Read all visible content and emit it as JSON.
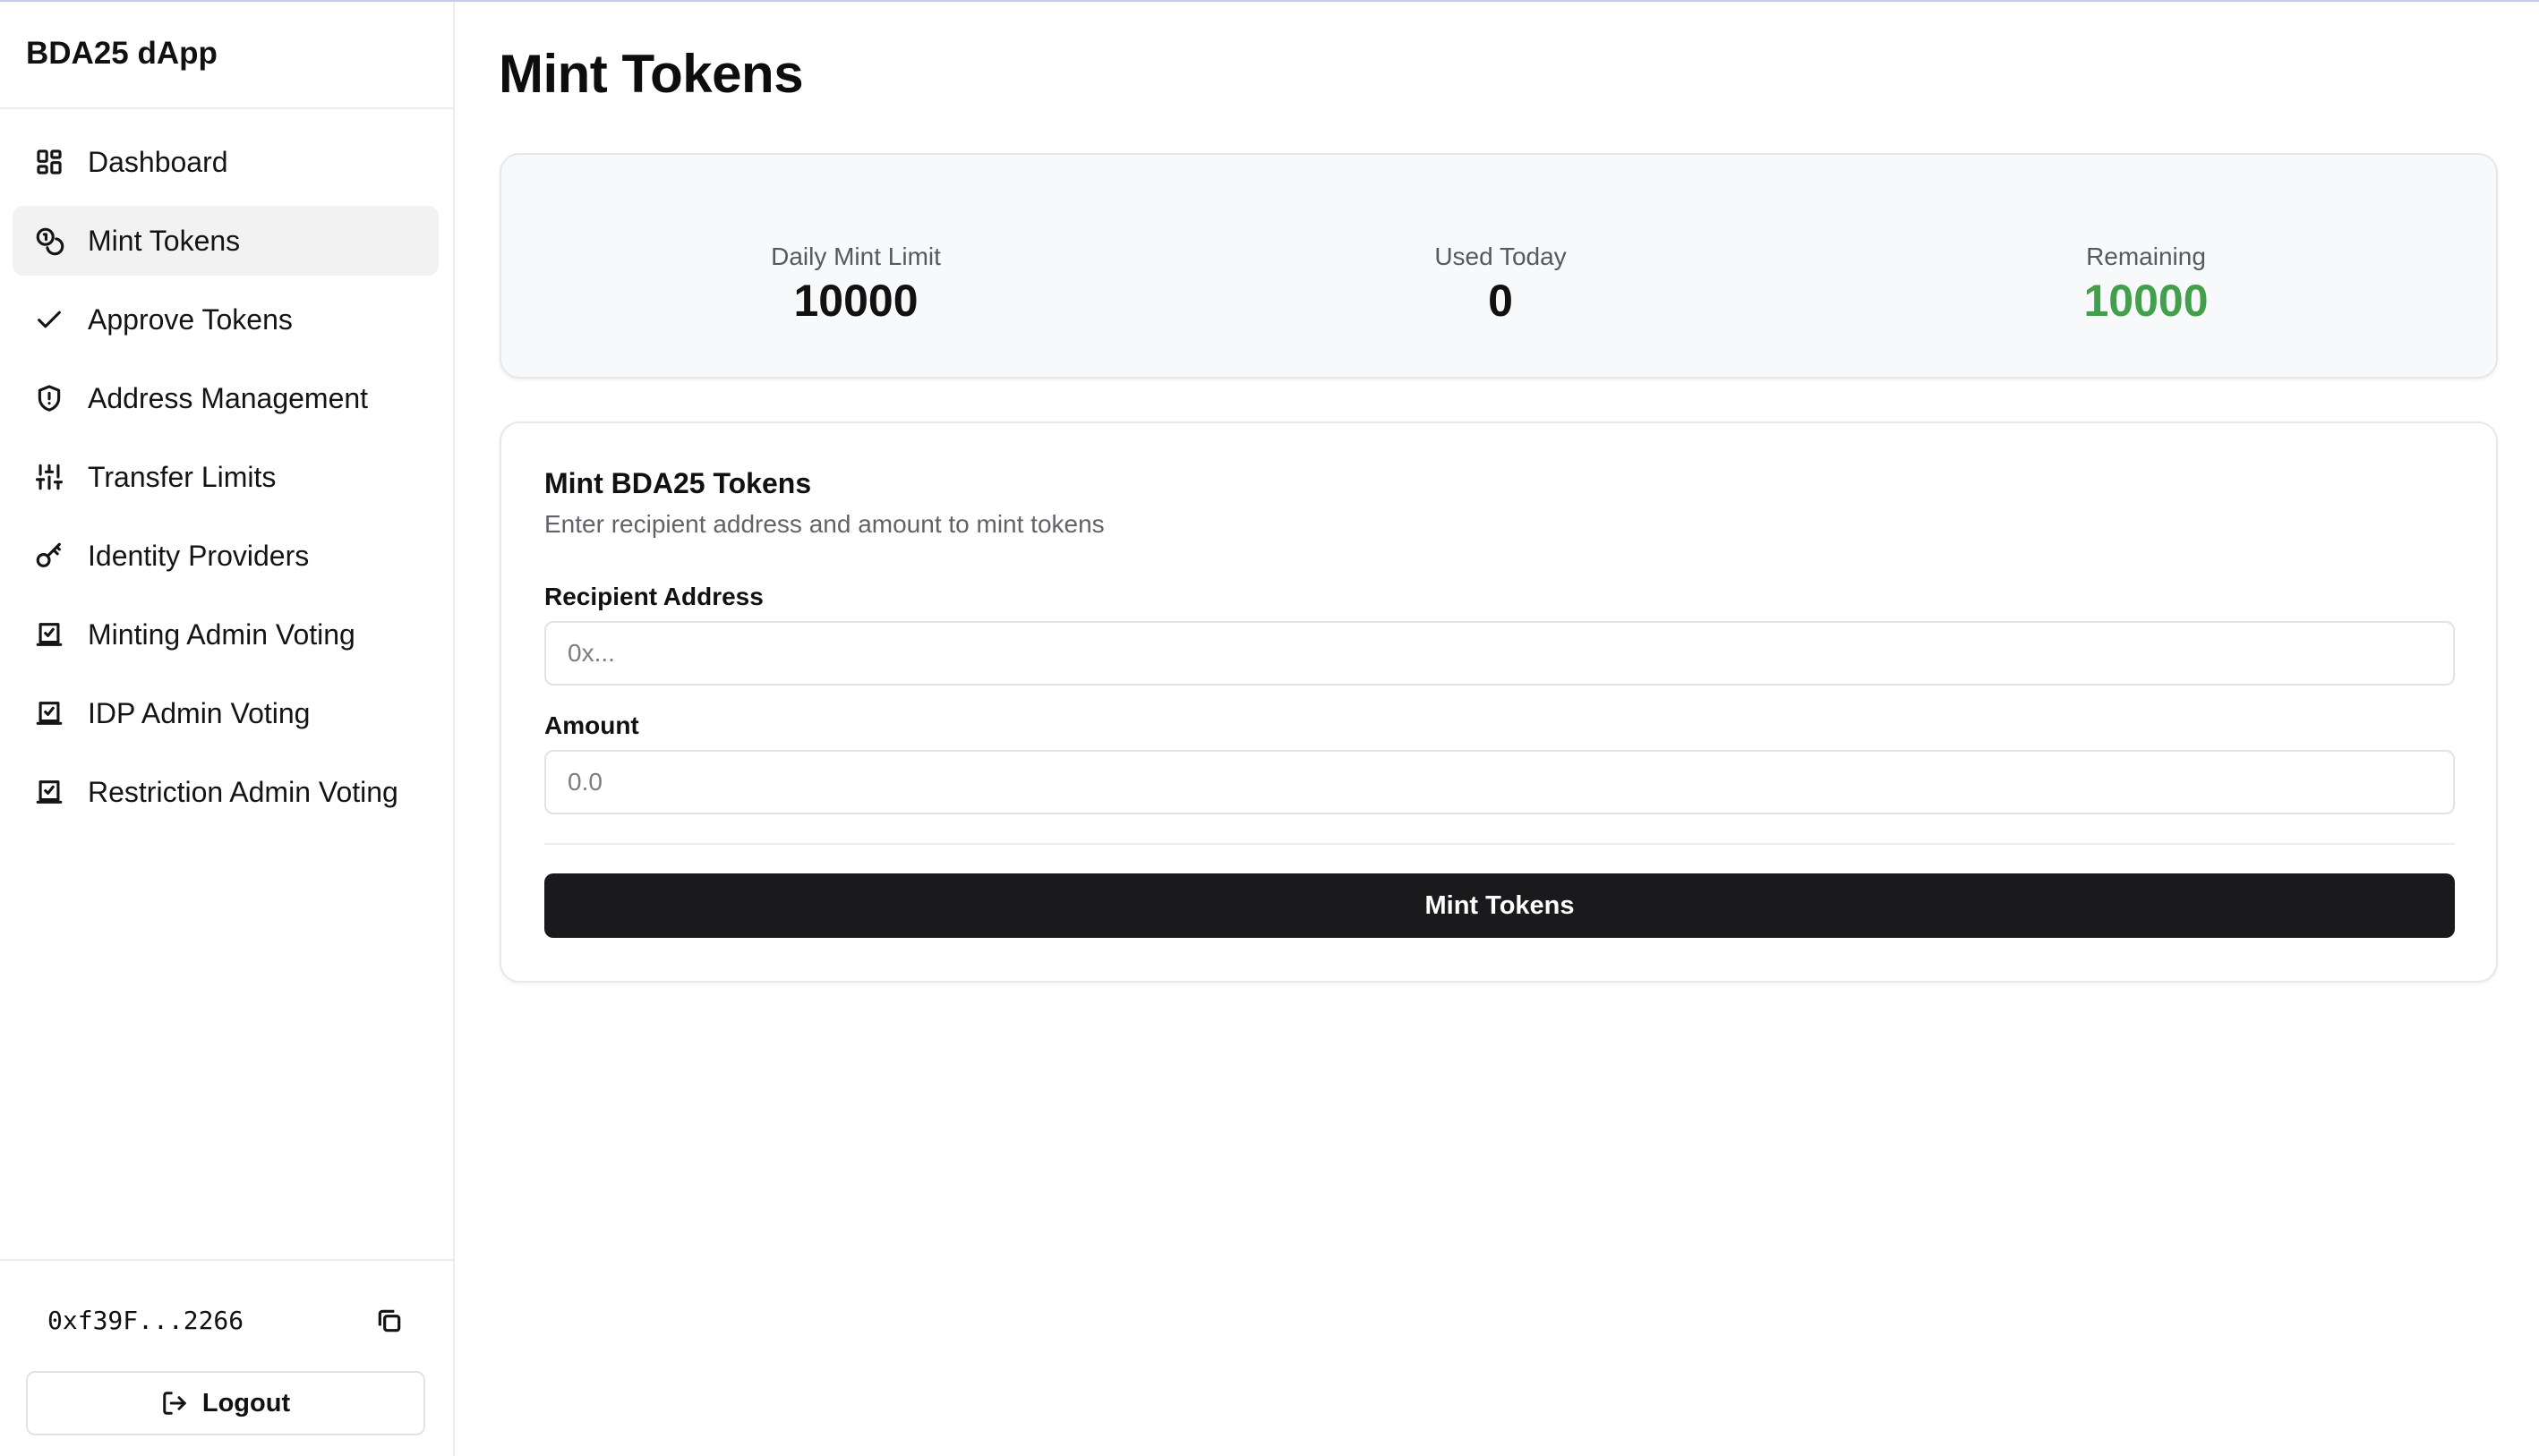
{
  "app": {
    "brand": "BDA25 dApp"
  },
  "sidebar": {
    "items": [
      {
        "label": "Dashboard",
        "icon": "dashboard-icon",
        "active": false
      },
      {
        "label": "Mint Tokens",
        "icon": "coins-icon",
        "active": true
      },
      {
        "label": "Approve Tokens",
        "icon": "check-icon",
        "active": false
      },
      {
        "label": "Address Management",
        "icon": "shield-icon",
        "active": false
      },
      {
        "label": "Transfer Limits",
        "icon": "sliders-icon",
        "active": false
      },
      {
        "label": "Identity Providers",
        "icon": "key-icon",
        "active": false
      },
      {
        "label": "Minting Admin Voting",
        "icon": "vote-icon",
        "active": false
      },
      {
        "label": "IDP Admin Voting",
        "icon": "vote-icon",
        "active": false
      },
      {
        "label": "Restriction Admin Voting",
        "icon": "vote-icon",
        "active": false
      }
    ],
    "footer": {
      "wallet_address": "0xf39F...2266",
      "copy_icon": "copy-icon",
      "logout_label": "Logout",
      "logout_icon": "logout-icon"
    }
  },
  "main": {
    "title": "Mint Tokens",
    "stats": [
      {
        "label": "Daily Mint Limit",
        "value": "10000",
        "color": "#111111"
      },
      {
        "label": "Used Today",
        "value": "0",
        "color": "#111111"
      },
      {
        "label": "Remaining",
        "value": "10000",
        "color": "#43a04a"
      }
    ],
    "form": {
      "title": "Mint BDA25 Tokens",
      "description": "Enter recipient address and amount to mint tokens",
      "recipient": {
        "label": "Recipient Address",
        "placeholder": "0x...",
        "value": ""
      },
      "amount": {
        "label": "Amount",
        "placeholder": "0.0",
        "value": ""
      },
      "submit_label": "Mint Tokens"
    }
  },
  "colors": {
    "accent_dark": "#1a1a1c",
    "remaining_green": "#43a04a",
    "active_nav_bg": "#f2f2f3"
  }
}
